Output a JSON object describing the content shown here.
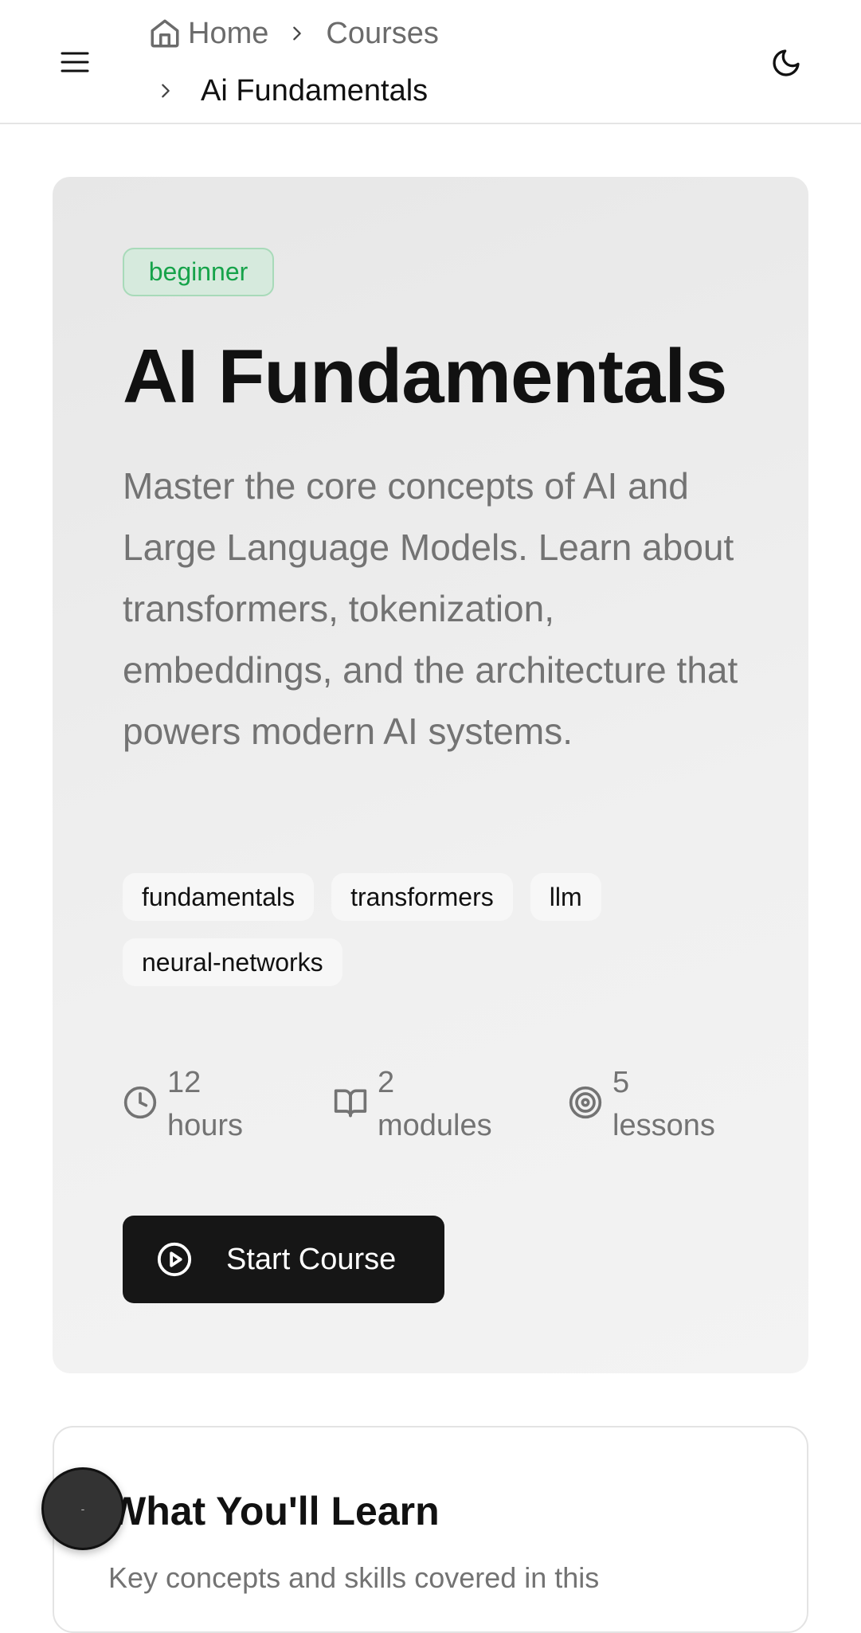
{
  "header": {
    "menu_icon": "hamburger-menu-icon",
    "theme_icon": "moon-icon",
    "breadcrumb": {
      "home_label": "Home",
      "courses_label": "Courses",
      "current_label": "Ai Fundamentals"
    }
  },
  "course": {
    "level_badge": "beginner",
    "title": "AI Fundamentals",
    "description": "Master the core concepts of AI and Large Language Models. Learn about transformers, tokenization, embeddings, and the architecture that powers modern AI systems.",
    "tags": [
      "fundamentals",
      "transformers",
      "llm",
      "neural-networks"
    ],
    "stats": {
      "duration": {
        "number": "12",
        "unit": "hours",
        "icon": "clock-icon"
      },
      "modules": {
        "number": "2",
        "unit": "modules",
        "icon": "book-open-icon"
      },
      "lessons": {
        "number": "5",
        "unit": "lessons",
        "icon": "target-icon"
      }
    },
    "start_button": "Start Course"
  },
  "learn": {
    "title": "What You'll Learn",
    "description": "Key concepts and skills covered in this"
  },
  "fab": {
    "label": "-"
  },
  "colors": {
    "badge_text": "#16a34a",
    "badge_bg": "#d6eadd",
    "primary_button": "#161616",
    "muted_text": "#737373"
  }
}
